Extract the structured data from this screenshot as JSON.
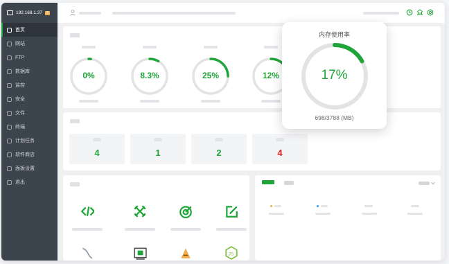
{
  "sidebar": {
    "host": "192.168.1.37",
    "badge": "2",
    "items": [
      {
        "label": "首页",
        "active": true
      },
      {
        "label": "网站"
      },
      {
        "label": "FTP"
      },
      {
        "label": "数据库"
      },
      {
        "label": "监控"
      },
      {
        "label": "安全"
      },
      {
        "label": "文件"
      },
      {
        "label": "终端"
      },
      {
        "label": "计划任务"
      },
      {
        "label": "软件商店"
      },
      {
        "label": "面板设置"
      },
      {
        "label": "退出"
      }
    ]
  },
  "status": {
    "gauges": [
      {
        "value": "0%",
        "percent": 0.02
      },
      {
        "value": "8.3%",
        "percent": 0.083
      },
      {
        "value": "25%",
        "percent": 0.25
      },
      {
        "value": "12%",
        "percent": 0.12
      }
    ]
  },
  "overview": {
    "cards": [
      {
        "value": "4",
        "color": "#20a53a"
      },
      {
        "value": "1",
        "color": "#20a53a"
      },
      {
        "value": "2",
        "color": "#20a53a"
      },
      {
        "value": "4",
        "color": "#e02020"
      }
    ]
  },
  "memory_popup": {
    "title": "内存使用率",
    "value": "17%",
    "percent": 0.17,
    "detail": "698/3788 (MB)"
  },
  "software": {
    "icons": [
      "code-icon",
      "tools-icon",
      "target-icon",
      "edit-icon",
      "mysql-icon",
      "terminal-icon",
      "tomcat-icon",
      "nodejs-icon"
    ]
  },
  "colors": {
    "accent": "#20a53a",
    "danger": "#e02020",
    "sidebar": "#3c444d"
  }
}
